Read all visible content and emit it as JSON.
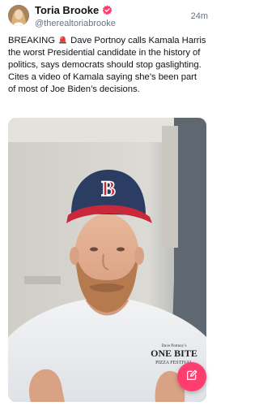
{
  "author": {
    "display_name": "Toria Brooke",
    "handle": "@therealtoriabrooke",
    "verified": true,
    "verified_color": "#ff3d6e"
  },
  "timestamp": "24m",
  "post": {
    "text_before_emoji": "BREAKING",
    "emoji": "siren-icon",
    "text_after_emoji": " Dave Portnoy calls Kamala Harris the worst Presidential candidate in the history of politics, says democrats should stop gaslighting. Cites a video of Kamala saying she’s been part of most of Joe Biden’s decisions."
  },
  "media": {
    "type": "video-thumbnail",
    "cap_letter": "B",
    "shirt_text_line1": "Dave Portnoy’s",
    "shirt_text_line2": "ONE BITE",
    "shirt_text_line3": "PIZZA FESTIVAL"
  },
  "compose_button": {
    "icon": "compose-icon",
    "color": "#ff3d6e"
  }
}
